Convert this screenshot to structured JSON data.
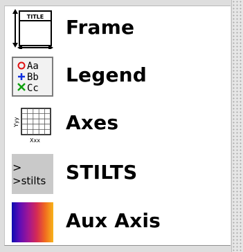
{
  "controls": {
    "items": [
      {
        "label": "Frame",
        "icon": "frame-title-icon",
        "icon_text": "TITLE"
      },
      {
        "label": "Legend",
        "icon": "legend-icon",
        "icon_rows": [
          {
            "marker": "o",
            "marker_color": "#e01010",
            "text": "Aa"
          },
          {
            "marker": "+",
            "marker_color": "#1030e0",
            "text": "Bb"
          },
          {
            "marker": "×",
            "marker_color": "#10a010",
            "text": "Cc"
          }
        ]
      },
      {
        "label": "Axes",
        "icon": "axes-grid-icon",
        "icon_xlabel": "Xxx",
        "icon_ylabel": "Yyy"
      },
      {
        "label": "STILTS",
        "icon": "stilts-command-icon",
        "icon_line1": ">",
        "icon_line2": ">stilts"
      },
      {
        "label": "Aux Axis",
        "icon": "aux-axis-colormap-icon"
      }
    ]
  }
}
